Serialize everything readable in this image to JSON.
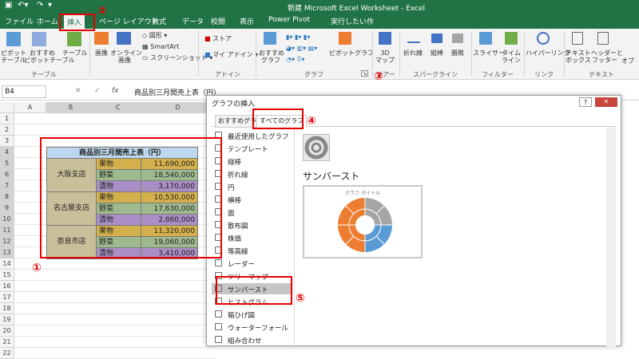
{
  "window": {
    "title": "新建 Microsoft Excel Worksheet - Excel"
  },
  "tabs": [
    {
      "label": "ファイル"
    },
    {
      "label": "ホーム"
    },
    {
      "label": "挿入"
    },
    {
      "label": "ページ レイアウト"
    },
    {
      "label": "数式"
    },
    {
      "label": "データ"
    },
    {
      "label": "校閲"
    },
    {
      "label": "表示"
    },
    {
      "label": "Power Pivot"
    },
    {
      "label": "実行したい作"
    }
  ],
  "ribbon": {
    "table_group": {
      "pivot": "ピボット\nテーブル",
      "rec_pivot": "おすすめ\nピボットテーブル",
      "table": "テーブル",
      "label": "テーブル"
    },
    "illust_group": {
      "pictures": "画像",
      "online": "オンライン\n画像",
      "shapes": "図形",
      "smartart": "SmartArt",
      "screenshot": "スクリーンショット"
    },
    "addin_group": {
      "store": "ストア",
      "myaddin": "マイ アドイン",
      "label": "アドイン"
    },
    "chart_group": {
      "rec": "おすすめ\nグラフ",
      "pivotchart": "ピボットグラフ",
      "label": "グラフ"
    },
    "tour_group": {
      "map3d": "3D\nマップ",
      "label": "ツアー"
    },
    "spark_group": {
      "line": "折れ線",
      "col": "縦棒",
      "winloss": "勝敗",
      "label": "スパークライン"
    },
    "filter_group": {
      "slicer": "スライサー",
      "timeline": "タイム\nライン",
      "label": "フィルター"
    },
    "link_group": {
      "hyperlink": "ハイパーリンク",
      "label": "リンク"
    },
    "text_group": {
      "textbox": "テキスト\nボックス",
      "header": "ヘッダーと\nフッター",
      "obj": "オブ",
      "label": "テキスト"
    }
  },
  "formula_bar": {
    "name_box": "B4",
    "fx": "fx",
    "content": "商品別三月間売上表（円）"
  },
  "columns": [
    "A",
    "B",
    "C",
    "D"
  ],
  "rows": [
    "1",
    "2",
    "3",
    "4",
    "5",
    "6",
    "7",
    "8",
    "9",
    "10",
    "11",
    "12",
    "13",
    "14",
    "15",
    "16",
    "17",
    "18",
    "19",
    "20",
    "21",
    "22"
  ],
  "table": {
    "header": "商品別三月間売上表（円）",
    "stores": [
      "大阪支店",
      "名古屋支店",
      "奈良市店"
    ],
    "rows": [
      {
        "item": "果物",
        "value": "11,690,000"
      },
      {
        "item": "野菜",
        "value": "18,540,000"
      },
      {
        "item": "漬物",
        "value": "3,170,000"
      },
      {
        "item": "果物",
        "value": "10,530,000"
      },
      {
        "item": "野菜",
        "value": "17,630,000"
      },
      {
        "item": "漬物",
        "value": "2,860,000"
      },
      {
        "item": "果物",
        "value": "11,320,000"
      },
      {
        "item": "野菜",
        "value": "19,060,000"
      },
      {
        "item": "漬物",
        "value": "3,410,000"
      }
    ],
    "colors": {
      "header": "#bdd7ee",
      "store": "#c9bf9a",
      "fruit": "#d4b04c",
      "veg": "#9fb98e",
      "pickle": "#a98fc5"
    }
  },
  "dialog": {
    "title": "グラフの挿入",
    "help": "?",
    "close": "✕",
    "tab_recommended": "おすすめグラフ",
    "tab_all": "すべてのグラフ",
    "chart_types": [
      "最近使用したグラフ",
      "テンプレート",
      "縦棒",
      "折れ線",
      "円",
      "横棒",
      "面",
      "散布図",
      "株価",
      "等高線",
      "レーダー",
      "ツリーマップ",
      "サンバースト",
      "ヒストグラム",
      "箱ひげ図",
      "ウォーターフォール",
      "組み合わせ"
    ],
    "selected": "サンバースト",
    "heading": "サンバースト",
    "preview_title": "グラフ タイトル"
  },
  "annotations": [
    "①",
    "②",
    "③",
    "④",
    "⑤"
  ],
  "accent": "#217346",
  "annotation_color": "#e60000"
}
